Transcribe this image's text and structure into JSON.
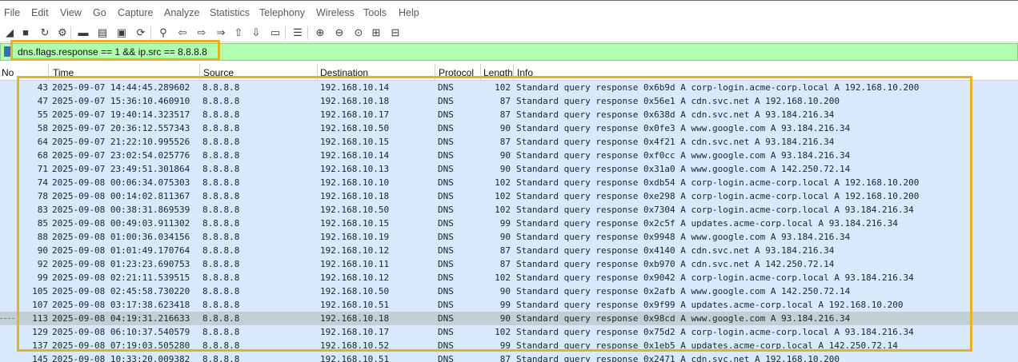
{
  "menu": [
    "File",
    "Edit",
    "View",
    "Go",
    "Capture",
    "Analyze",
    "Statistics",
    "Telephony",
    "Wireless",
    "Tools",
    "Help"
  ],
  "toolbar": {
    "icons": [
      "shark-fin-start-icon",
      "stop-capture-icon",
      "restart-capture-icon",
      "capture-options-icon",
      "open-file-icon",
      "save-file-icon",
      "close-file-icon",
      "reload-file-icon",
      "find-packet-icon",
      "go-back-icon",
      "go-forward-icon",
      "go-to-packet-icon",
      "go-first-icon",
      "go-last-icon",
      "autoscroll-icon",
      "colorize-icon",
      "zoom-in-icon",
      "zoom-out-icon",
      "zoom-normal-icon",
      "resize-columns-icon",
      "more-icon"
    ],
    "glyphs": [
      "◢",
      "■",
      "↻",
      "⚙",
      "▬",
      "▤",
      "▣",
      "⟳",
      "⚲",
      "⇦",
      "⇨",
      "⇒",
      "⇧",
      "⇩",
      "▭",
      "☰",
      "⊕",
      "⊖",
      "⊙",
      "⊞",
      "⊟"
    ]
  },
  "filter": {
    "value": "dns.flags.response == 1 && ip.src == 8.8.8.8"
  },
  "columns": {
    "no": "No",
    "time": "Time",
    "source": "Source",
    "destination": "Destination",
    "protocol": "Protocol",
    "length": "Length",
    "info": "Info"
  },
  "packets": [
    {
      "no": "43",
      "time": "2025-09-07 14:44:45.289602",
      "src": "8.8.8.8",
      "dst": "192.168.10.14",
      "proto": "DNS",
      "len": "102",
      "info": "Standard query response 0x6b9d A corp-login.acme-corp.local A 192.168.10.200"
    },
    {
      "no": "47",
      "time": "2025-09-07 15:36:10.460910",
      "src": "8.8.8.8",
      "dst": "192.168.10.18",
      "proto": "DNS",
      "len": "87",
      "info": "Standard query response 0x56e1 A cdn.svc.net A 192.168.10.200"
    },
    {
      "no": "55",
      "time": "2025-09-07 19:40:14.323517",
      "src": "8.8.8.8",
      "dst": "192.168.10.17",
      "proto": "DNS",
      "len": "87",
      "info": "Standard query response 0x638d A cdn.svc.net A 93.184.216.34"
    },
    {
      "no": "58",
      "time": "2025-09-07 20:36:12.557343",
      "src": "8.8.8.8",
      "dst": "192.168.10.50",
      "proto": "DNS",
      "len": "90",
      "info": "Standard query response 0x0fe3 A www.google.com A 93.184.216.34"
    },
    {
      "no": "64",
      "time": "2025-09-07 21:22:10.995526",
      "src": "8.8.8.8",
      "dst": "192.168.10.15",
      "proto": "DNS",
      "len": "87",
      "info": "Standard query response 0x4f21 A cdn.svc.net A 93.184.216.34"
    },
    {
      "no": "68",
      "time": "2025-09-07 23:02:54.025776",
      "src": "8.8.8.8",
      "dst": "192.168.10.14",
      "proto": "DNS",
      "len": "90",
      "info": "Standard query response 0xf0cc A www.google.com A 93.184.216.34"
    },
    {
      "no": "71",
      "time": "2025-09-07 23:49:51.301864",
      "src": "8.8.8.8",
      "dst": "192.168.10.13",
      "proto": "DNS",
      "len": "90",
      "info": "Standard query response 0x31a0 A www.google.com A 142.250.72.14"
    },
    {
      "no": "74",
      "time": "2025-09-08 00:06:34.075303",
      "src": "8.8.8.8",
      "dst": "192.168.10.10",
      "proto": "DNS",
      "len": "102",
      "info": "Standard query response 0xdb54 A corp-login.acme-corp.local A 192.168.10.200"
    },
    {
      "no": "78",
      "time": "2025-09-08 00:14:02.811367",
      "src": "8.8.8.8",
      "dst": "192.168.10.18",
      "proto": "DNS",
      "len": "102",
      "info": "Standard query response 0xe298 A corp-login.acme-corp.local A 192.168.10.200"
    },
    {
      "no": "83",
      "time": "2025-09-08 00:38:31.869539",
      "src": "8.8.8.8",
      "dst": "192.168.10.50",
      "proto": "DNS",
      "len": "102",
      "info": "Standard query response 0x7304 A corp-login.acme-corp.local A 93.184.216.34"
    },
    {
      "no": "85",
      "time": "2025-09-08 00:49:03.911302",
      "src": "8.8.8.8",
      "dst": "192.168.10.15",
      "proto": "DNS",
      "len": "99",
      "info": "Standard query response 0x2c5f A updates.acme-corp.local A 93.184.216.34"
    },
    {
      "no": "88",
      "time": "2025-09-08 01:00:36.034156",
      "src": "8.8.8.8",
      "dst": "192.168.10.19",
      "proto": "DNS",
      "len": "90",
      "info": "Standard query response 0x9948 A www.google.com A 93.184.216.34"
    },
    {
      "no": "90",
      "time": "2025-09-08 01:01:49.170764",
      "src": "8.8.8.8",
      "dst": "192.168.10.12",
      "proto": "DNS",
      "len": "87",
      "info": "Standard query response 0x4140 A cdn.svc.net A 93.184.216.34"
    },
    {
      "no": "92",
      "time": "2025-09-08 01:23:23.690753",
      "src": "8.8.8.8",
      "dst": "192.168.10.11",
      "proto": "DNS",
      "len": "87",
      "info": "Standard query response 0xb970 A cdn.svc.net A 142.250.72.14"
    },
    {
      "no": "99",
      "time": "2025-09-08 02:21:11.539515",
      "src": "8.8.8.8",
      "dst": "192.168.10.12",
      "proto": "DNS",
      "len": "102",
      "info": "Standard query response 0x9042 A corp-login.acme-corp.local A 93.184.216.34"
    },
    {
      "no": "105",
      "time": "2025-09-08 02:45:58.730220",
      "src": "8.8.8.8",
      "dst": "192.168.10.50",
      "proto": "DNS",
      "len": "90",
      "info": "Standard query response 0x2afb A www.google.com A 142.250.72.14"
    },
    {
      "no": "107",
      "time": "2025-09-08 03:17:38.623418",
      "src": "8.8.8.8",
      "dst": "192.168.10.51",
      "proto": "DNS",
      "len": "99",
      "info": "Standard query response 0x9f99 A updates.acme-corp.local A 192.168.10.200"
    },
    {
      "no": "113",
      "time": "2025-09-08 04:19:31.216633",
      "src": "8.8.8.8",
      "dst": "192.168.10.18",
      "proto": "DNS",
      "len": "90",
      "info": "Standard query response 0x98cd A www.google.com A 93.184.216.34",
      "selected": true
    },
    {
      "no": "129",
      "time": "2025-09-08 06:10:37.540579",
      "src": "8.8.8.8",
      "dst": "192.168.10.17",
      "proto": "DNS",
      "len": "102",
      "info": "Standard query response 0x75d2 A corp-login.acme-corp.local A 93.184.216.34"
    },
    {
      "no": "137",
      "time": "2025-09-08 07:19:03.505280",
      "src": "8.8.8.8",
      "dst": "192.168.10.52",
      "proto": "DNS",
      "len": "99",
      "info": "Standard query response 0x1eb5 A updates.acme-corp.local A 142.250.72.14"
    },
    {
      "no": "145",
      "time": "2025-09-08 10:33:20.009382",
      "src": "8.8.8.8",
      "dst": "192.168.10.51",
      "proto": "DNS",
      "len": "87",
      "info": "Standard query response 0x2471 A cdn.svc.net A 192.168.10.200"
    }
  ]
}
